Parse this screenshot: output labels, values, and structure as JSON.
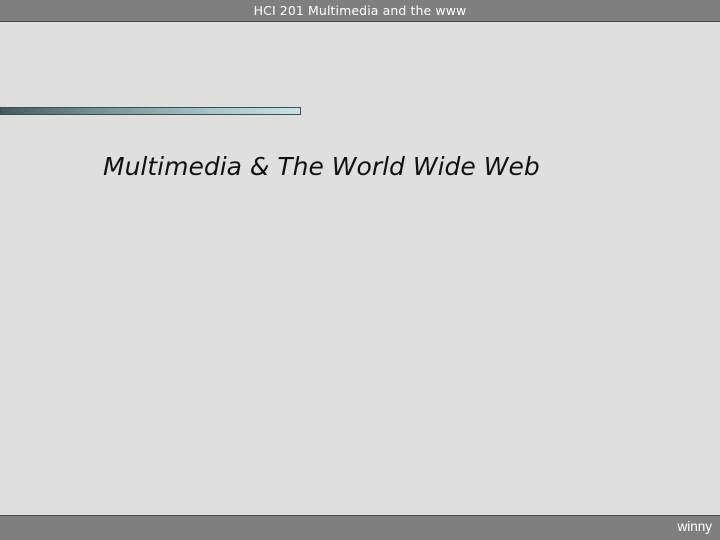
{
  "header": {
    "text": "HCI 201 Multimedia and the www"
  },
  "slide": {
    "title": "Multimedia & The World Wide Web"
  },
  "footer": {
    "text": "winny"
  },
  "colors": {
    "background": "#dfdfdf",
    "bar": "#7f7f7f",
    "accent": "#a5c6c6"
  }
}
